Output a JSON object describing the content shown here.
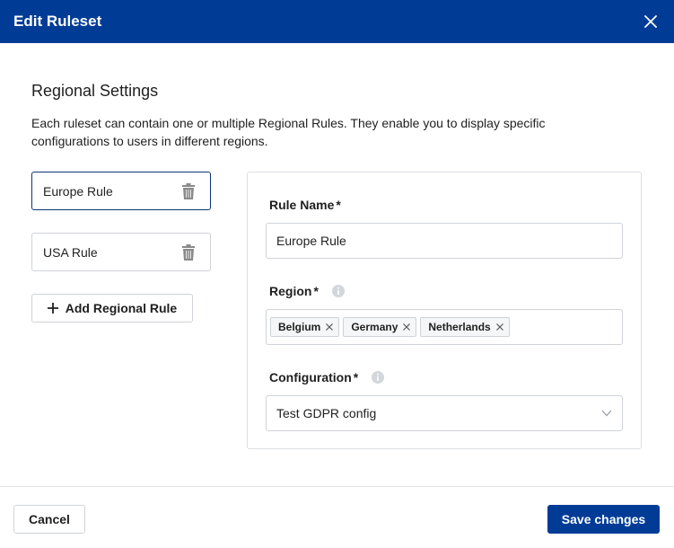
{
  "modal": {
    "title": "Edit Ruleset"
  },
  "section": {
    "title": "Regional Settings",
    "description": "Each ruleset can contain one or multiple Regional Rules. They enable you to display specific configurations to users in different regions."
  },
  "rules": {
    "items": [
      {
        "label": "Europe Rule",
        "active": true
      },
      {
        "label": "USA Rule",
        "active": false
      }
    ],
    "add_label": "Add Regional Rule"
  },
  "form": {
    "rule_name": {
      "label": "Rule Name",
      "required_mark": "*",
      "value": "Europe Rule"
    },
    "region": {
      "label": "Region",
      "required_mark": "*",
      "tags": [
        "Belgium",
        "Germany",
        "Netherlands"
      ]
    },
    "configuration": {
      "label": "Configuration",
      "required_mark": "*",
      "selected": "Test GDPR config"
    }
  },
  "footer": {
    "cancel_label": "Cancel",
    "save_label": "Save changes"
  },
  "colors": {
    "brand": "#003c96",
    "border": "#cfd3d8",
    "active_border": "#0d3473",
    "icon_gray": "#8a8a8a"
  },
  "icons": {
    "close": "close-icon",
    "trash": "trash-icon",
    "plus": "plus-icon",
    "info": "info-icon",
    "tag_remove": "x-icon",
    "dropdown": "chevron-down-icon"
  }
}
